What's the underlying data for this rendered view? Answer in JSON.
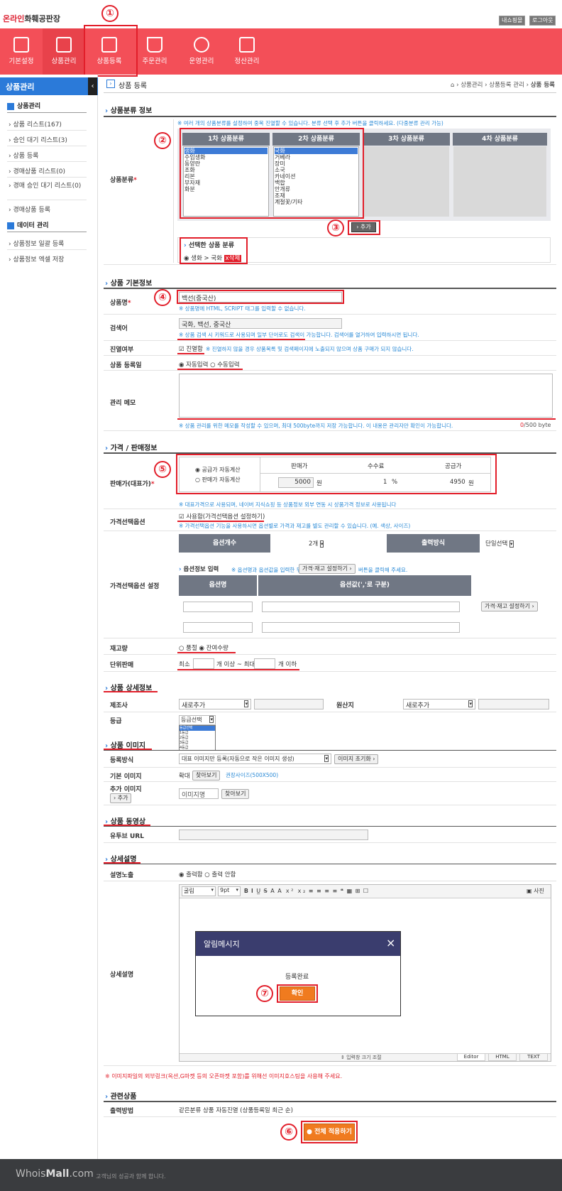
{
  "header": {
    "logo_red": "온라인",
    "logo_rest": "화훼공판장",
    "links": [
      "내쇼핑몰",
      "로그아웃"
    ]
  },
  "nav": [
    {
      "label": "기본설정",
      "icon": "monitor-icon"
    },
    {
      "label": "상품관리",
      "icon": "gift-icon"
    },
    {
      "label": "상품등록",
      "icon": "clipboard-icon"
    },
    {
      "label": "주문관리",
      "icon": "basket-icon"
    },
    {
      "label": "운영관리",
      "icon": "gear-icon"
    },
    {
      "label": "정산관리",
      "icon": "won-icon"
    }
  ],
  "sidebar": {
    "title": "상품관리",
    "group1": "상품관리",
    "items1": [
      "상품 리스트(167)",
      "승인 대기 리스트(3)",
      "상품 등록",
      "경매상품 리스트(0)",
      "경매 승인 대기 리스트(0)",
      "경매상품 등록"
    ],
    "group2": "데이터 관리",
    "items2": [
      "상품정보 일괄 등록",
      "상품정보 엑셀 저장"
    ]
  },
  "page": {
    "title": "상품 등록",
    "breadcrumb_1": "상품관리",
    "breadcrumb_2": "상품등록 관리",
    "breadcrumb_3": "상품 등록"
  },
  "markers": [
    "①",
    "②",
    "③",
    "④",
    "⑤",
    "⑥",
    "⑦"
  ],
  "category": {
    "section": "상품분류 정보",
    "label": "상품분류",
    "note": "※ 여러 개의 상품분류를 설정하여 중복 진열할 수 있습니다. 분류 선택 후 추가 버튼을 클릭하세요. (다중분류 관리 가능)",
    "col1": "1차 상품분류",
    "col2": "2차 상품분류",
    "col3": "3차 상품분류",
    "col4": "4차 상품분류",
    "list1": [
      "생화",
      "수입생화",
      "동양란",
      "조화",
      "리본",
      "부자재",
      "화분"
    ],
    "list2": [
      "국화",
      "거베라",
      "장미",
      "소국",
      "카네이션",
      "백합",
      "안개류",
      "조재",
      "계절꽃/기타"
    ],
    "add": "› 추가",
    "selected_title": "선택한 상품 분류",
    "selected_value": "생화 > 국화",
    "delete": "x삭제"
  },
  "basic": {
    "section": "상품 기본정보",
    "name_label": "상품명",
    "name_value": "백선(중국산)",
    "name_note": "※ 상품명에 HTML, SCRIPT 태그를 입력할 수 없습니다.",
    "search_label": "검색어",
    "search_value": "국화, 백선, 중국산",
    "search_note": "※ 상품 검색 시 키워드로 사용되며 일부 단어로도 검색이 가능합니다. 검색어를 열거하여 입력하시면 됩니다.",
    "display_label": "진열여부",
    "display_value": "진열함",
    "display_note": "※ 진열하지 않을 경우 상품목록 및 검색페이지에 노출되지 않으며 상품 구매가 되지 않습니다.",
    "regday_label": "상품 등록일",
    "reg_auto": "자동입력",
    "reg_manual": "수동입력",
    "memo_label": "관리 메모",
    "memo_note": "※ 상품 관리를 위한 메모를 작성할 수 있으며, 최대 500byte까지 저장 가능합니다. 이 내용은 관리자만 확인이 가능합니다.",
    "memo_count_used": "0",
    "memo_count_max": "/500 byte"
  },
  "price": {
    "section": "가격 / 판매정보",
    "label": "판매가(대표가)",
    "opt1": "공급가 자동계산",
    "opt2": "판매가 자동계산",
    "col_sale": "판매가",
    "col_fee": "수수료",
    "col_supply": "공급가",
    "sale_value": "5000",
    "sale_unit": "원",
    "fee_value": "1",
    "fee_unit": "%",
    "supply_value": "4950",
    "supply_unit": "원",
    "note": "※ 대표가격으로 사용되며, 네이버 지식쇼핑 등 상품정보 외부 연동 시 상품가격 정보로 사용됩니다",
    "option_label": "가격선택옵션",
    "option_value": "사용함(가격선택옵션 설정하기)",
    "option_note": "※ 가격선택옵션 기능을 사용하시면 옵션별로 가격과 재고를 별도 관리할 수 있습니다. (예. 색상, 사이즈)",
    "option_set_label": "가격선택옵션 설정",
    "opt_count_label": "옵션개수",
    "opt_count_value": "2개",
    "out_mode_label": "출력방식",
    "out_mode_value": "단일선택",
    "opt_info_title": "옵션정보 입력",
    "opt_info_note1": "※ 옵션명과 옵션값을 입력한 뒤",
    "opt_info_btn": "가격·재고 설정하기 ›",
    "opt_info_note2": "버튼을 클릭해 주세요.",
    "opt_name_col": "옵션명",
    "opt_value_col": "옵션값(','로 구분)",
    "opt_set_btn": "가격·재고 설정하기 ›",
    "stock_label": "재고량",
    "stock_soldout": "품절",
    "stock_remain": "잔여수량",
    "unit_label": "단위판매",
    "unit_min": "최소",
    "unit_mid": "개 이상 ~ 최대",
    "unit_max": "개 이하"
  },
  "detail": {
    "section": "상품 상세정보",
    "maker_label": "제조사",
    "maker_value": "새로추가",
    "origin_label": "원산지",
    "origin_value": "새로추가",
    "grade_label": "등급",
    "grade_value": "등급선택",
    "grade_options": [
      "등급선택",
      "1등급",
      "2등급",
      "3등급",
      "4등급"
    ]
  },
  "image": {
    "section": "상품 이미지",
    "mode_label": "등록방식",
    "mode_value": "대표 이미지만 등록(자동으로 작은 이미지 생성)",
    "reset_btn": "이미지 초기화 ›",
    "base_label": "기본 이미지",
    "base_zoom": "확대",
    "browse": "찾아보기",
    "base_note": "권장사이즈(500X500)",
    "extra_label": "추가 이미지",
    "extra_add": "› 추가",
    "extra_placeholder": "이미지명"
  },
  "video": {
    "section": "상품 동영상",
    "label": "유투브 URL"
  },
  "desc": {
    "section": "상세설명",
    "show_label": "설명노출",
    "show_yes": "출력함",
    "show_no": "출력 안함",
    "label": "상세설명",
    "font": "굴림",
    "size": "9pt",
    "photo": "사진",
    "resize": "⇕ 입력창 크기 조절",
    "tabs": [
      "Editor",
      "HTML",
      "TEXT"
    ],
    "warn": "※ 이미지파일의 외부링크(옥션,G마켓 등의 오픈마켓 포함)를 위해선 이미지호스팅을 사용해 주세요."
  },
  "modal": {
    "title": "알림메시지",
    "message": "등록완료",
    "ok": "확인"
  },
  "related": {
    "section": "관련상품",
    "label": "출력방법",
    "value": "같은분류 상품 자동진열 (상품등록일 최근 순)"
  },
  "apply": "전체 적용하기",
  "footer": {
    "brand1": "Whois",
    "brand2": "Mall",
    "brand3": ".com",
    "slogan": "고객님의 성공과 함께 합니다."
  }
}
